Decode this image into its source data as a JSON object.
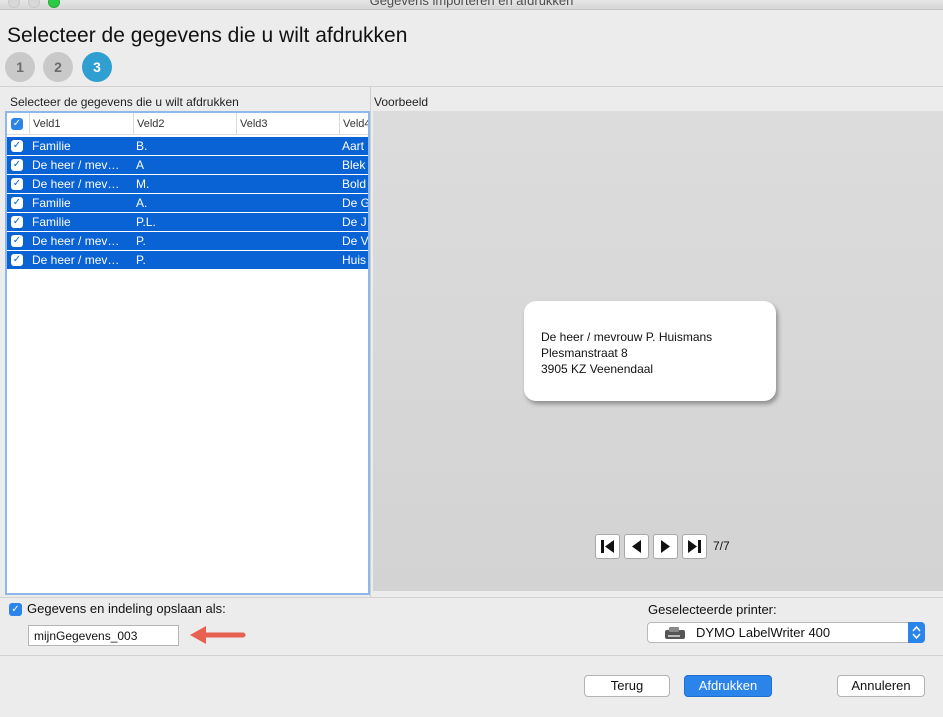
{
  "window": {
    "title": "Gegevens importeren en afdrukken"
  },
  "heading": "Selecteer de gegevens die u wilt afdrukken",
  "steps": [
    "1",
    "2",
    "3"
  ],
  "left_panel": {
    "label": "Selecteer de gegevens die u wilt afdrukken",
    "columns": [
      "Veld1",
      "Veld2",
      "Veld3",
      "Veld4"
    ],
    "rows": [
      [
        "Familie",
        "B.",
        "",
        "Aart"
      ],
      [
        "De heer / mev…",
        "A",
        "",
        "Blek"
      ],
      [
        "De heer / mev…",
        "M.",
        "",
        "Bold"
      ],
      [
        "Familie",
        "A.",
        "",
        "De G"
      ],
      [
        "Familie",
        "P.L.",
        "",
        "De J"
      ],
      [
        "De heer / mev…",
        "P.",
        "",
        "De V"
      ],
      [
        "De heer / mev…",
        "P.",
        "",
        "Huis"
      ]
    ]
  },
  "preview": {
    "label": "Voorbeeld",
    "address": [
      "De heer / mevrouw P.  Huismans",
      "Plesmanstraat 8",
      "3905 KZ Veenendaal"
    ],
    "counter": "7/7"
  },
  "save": {
    "checkbox_label": "Gegevens en indeling opslaan als:",
    "filename": "mijnGegevens_003"
  },
  "printer": {
    "label": "Geselecteerde printer:",
    "selected": "DYMO LabelWriter 400"
  },
  "buttons": {
    "back": "Terug",
    "print": "Afdrukken",
    "cancel": "Annuleren"
  },
  "colors": {
    "accent": "#2b84ea",
    "selection": "#0a63d4",
    "step_active": "#2e9fd0",
    "annotation_arrow": "#e8604f"
  }
}
